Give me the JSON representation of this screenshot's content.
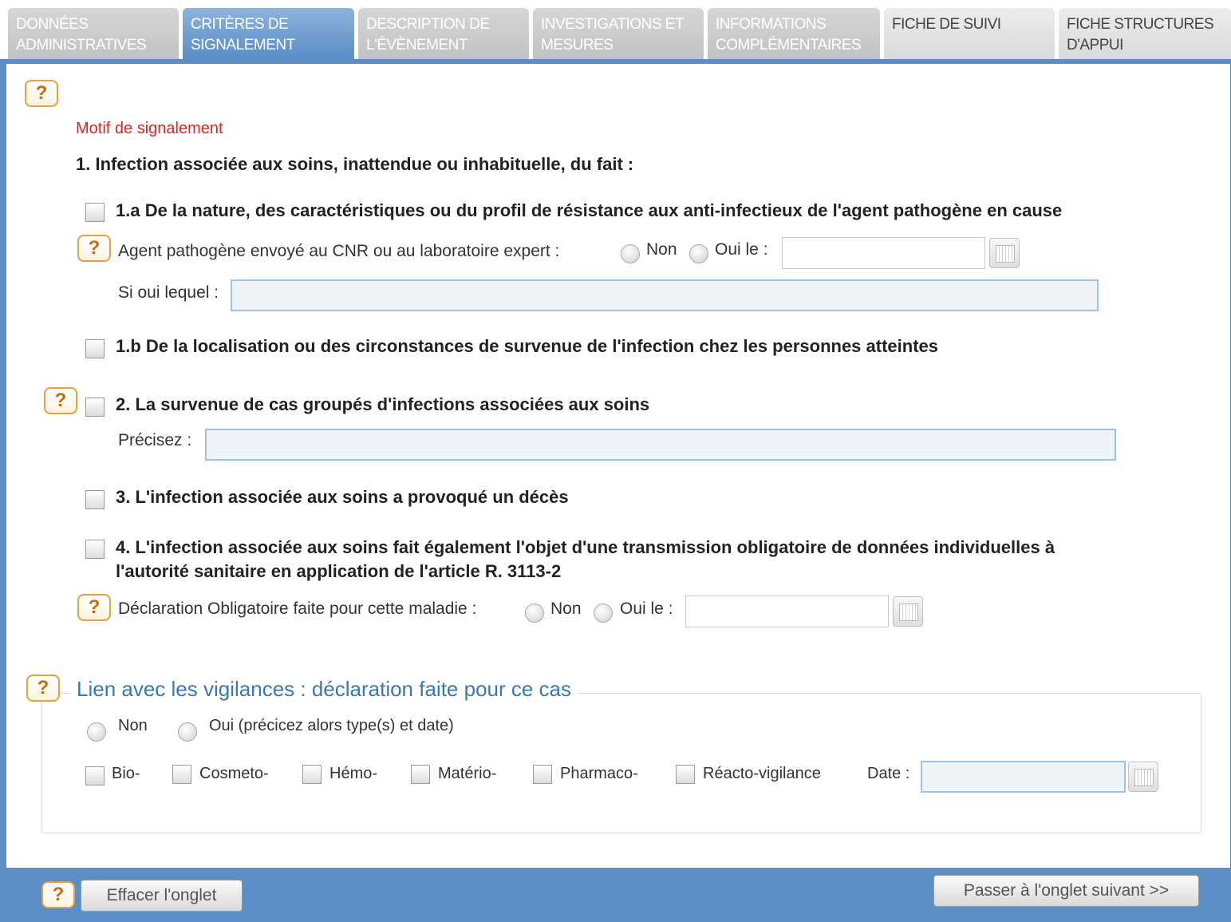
{
  "tabs": [
    {
      "line1": "DONNÉES",
      "line2": "ADMINISTRATIVES"
    },
    {
      "line1": "CRITÈRES DE",
      "line2": "SIGNALEMENT"
    },
    {
      "line1": "DESCRIPTION DE",
      "line2": "L'ÉVÈNEMENT"
    },
    {
      "line1": "INVESTIGATIONS ET",
      "line2": "MESURES"
    },
    {
      "line1": "INFORMATIONS",
      "line2": "COMPLÉMENTAIRES"
    },
    {
      "line1": "FICHE DE SUIVI",
      "line2": ""
    },
    {
      "line1": "FICHE STRUCTURES",
      "line2": "D'APPUI"
    }
  ],
  "active_tab_index": 1,
  "help_label": "?",
  "section": {
    "motif_label": "Motif de signalement",
    "q1_title": "1. Infection associée aux soins, inattendue ou inhabituelle, du fait :",
    "q1a_label": "1.a De la nature, des caractéristiques ou du profil de résistance aux anti-infectieux de l'agent pathogène en cause",
    "agent_label": "Agent pathogène envoyé au CNR ou au laboratoire expert :",
    "non_label": "Non",
    "oui_le_label": "Oui le :",
    "si_oui_label": "Si oui lequel :",
    "q1b_label": "1.b De la localisation ou des circonstances de survenue de l'infection chez les personnes atteintes",
    "q2_label": "2. La survenue de cas groupés d'infections associées aux soins",
    "precisez_label": "Précisez :",
    "q3_label": "3. L'infection associée aux soins a provoqué un décès",
    "q4_line1": "4. L'infection associée aux soins fait également l'objet d'une transmission obligatoire de données individuelles à",
    "q4_line2": "l'autorité sanitaire en application de l'article R. 3113-2",
    "do_label": "Déclaration Obligatoire faite pour cette maladie :",
    "do_non": "Non",
    "do_oui_le": "Oui le :"
  },
  "vigilances": {
    "title": "Lien avec les vigilances : déclaration faite pour ce cas",
    "non_label": "Non",
    "oui_label": "Oui (précicez alors type(s) et date)",
    "types": [
      "Bio-",
      "Cosmeto-",
      "Hémo-",
      "Matério-",
      "Pharmaco-",
      "Réacto-vigilance"
    ],
    "date_label": "Date :"
  },
  "footer": {
    "clear_label": "Effacer l'onglet",
    "next_label": "Passer à l'onglet suivant >>"
  },
  "colors": {
    "accent": "#5b8dc6",
    "help_border": "#e8a040",
    "motif_red": "#e32222",
    "vigilance_blue": "#3a77b5"
  }
}
